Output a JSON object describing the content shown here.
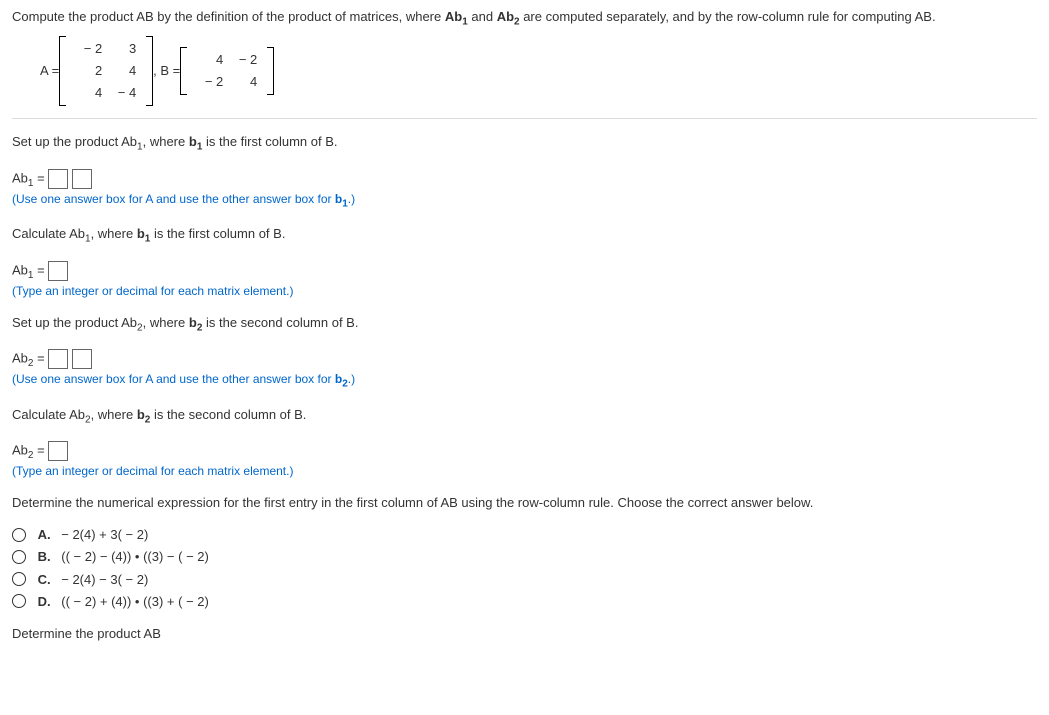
{
  "intro": "Compute the product AB by the definition of the product of matrices, where ",
  "intro_mid": " and ",
  "intro_end": " are computed separately, and by the row-column rule for computing AB.",
  "ab1_label": "Ab",
  "ab2_label": "Ab",
  "sub1": "1",
  "sub2": "2",
  "A_eq": "A = ",
  "B_eq": ", B = ",
  "A": [
    [
      "− 2",
      "3"
    ],
    [
      "2",
      "4"
    ],
    [
      "4",
      "− 4"
    ]
  ],
  "B": [
    [
      "4",
      "− 2"
    ],
    [
      "− 2",
      "4"
    ]
  ],
  "q1": {
    "line": "Set up the product Ab",
    "line_end": ", where ",
    "vec": "b",
    "tail": " is the first column of B.",
    "eq_prefix": "Ab",
    "eq_mid": " = ",
    "hint": "(Use one answer box for A and use the other answer box for ",
    "hint_end": ".)"
  },
  "q2": {
    "line": "Calculate Ab",
    "line_end": ", where ",
    "vec": "b",
    "tail": " is the first column of B.",
    "eq_prefix": "Ab",
    "eq_mid": " = ",
    "hint": "(Type an integer or decimal for each matrix element.)"
  },
  "q3": {
    "line": "Set up the product Ab",
    "line_end": ", where ",
    "vec": "b",
    "tail": " is the second column of B.",
    "eq_prefix": "Ab",
    "eq_mid": " = ",
    "hint": "(Use one answer box for A and use the other answer box for ",
    "hint_end": ".)"
  },
  "q4": {
    "line": "Calculate Ab",
    "line_end": ", where ",
    "vec": "b",
    "tail": " is the second column of B.",
    "eq_prefix": "Ab",
    "eq_mid": " = ",
    "hint": "(Type an integer or decimal for each matrix element.)"
  },
  "mc": {
    "prompt": "Determine the numerical expression for the first entry in the first column of AB using the row-column rule. Choose the correct answer below.",
    "options": {
      "A": "− 2(4) + 3( − 2)",
      "B": "(( − 2) − (4)) • ((3) − ( − 2)",
      "C": "− 2(4) − 3( − 2)",
      "D": "(( − 2) + (4)) • ((3) + ( − 2)"
    }
  },
  "cutoff": "Determine the product AB",
  "labels": {
    "A": "A.",
    "B": "B.",
    "C": "C.",
    "D": "D."
  }
}
